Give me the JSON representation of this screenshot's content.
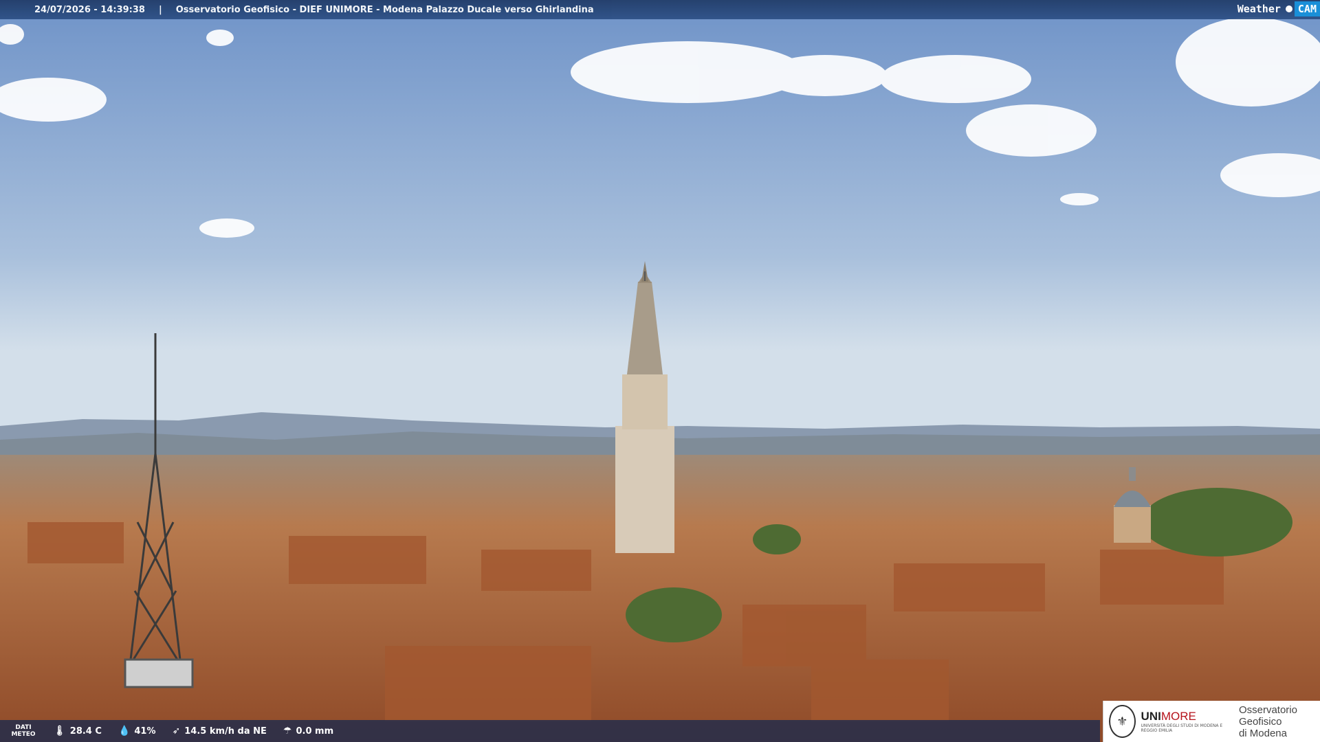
{
  "header": {
    "timestamp": "24/07/2026 - 14:39:38",
    "separator": "|",
    "title": "Osservatorio Geofisico - DIEF UNIMORE - Modena Palazzo Ducale verso Ghirlandina"
  },
  "webcam_logo": {
    "left": "Weather",
    "right": "CAM"
  },
  "weather": {
    "dati_label_line1": "DATI",
    "dati_label_line2": "METEO",
    "temperature": "28.4 C",
    "humidity": "41%",
    "wind": "14.5 km/h da NE",
    "rain": "0.0 mm"
  },
  "unimore": {
    "brand_a": "UNI",
    "brand_b": "MORE",
    "subtext": "UNIVERSITÀ DEGLI STUDI DI MODENA E REGGIO EMILIA",
    "osservatorio_line1": "Osservatorio Geofisico",
    "osservatorio_line2": "di Modena"
  },
  "colors": {
    "sky_top": "#6f93c8",
    "sky_horizon": "#c9d8e8",
    "roof": "#b86a3c",
    "tower": "#d8cbb8",
    "brand_red": "#b5121b"
  },
  "icons": {
    "temperature": "thermometer-icon",
    "humidity": "droplet-icon",
    "wind": "wind-icon",
    "rain": "rain-icon"
  }
}
